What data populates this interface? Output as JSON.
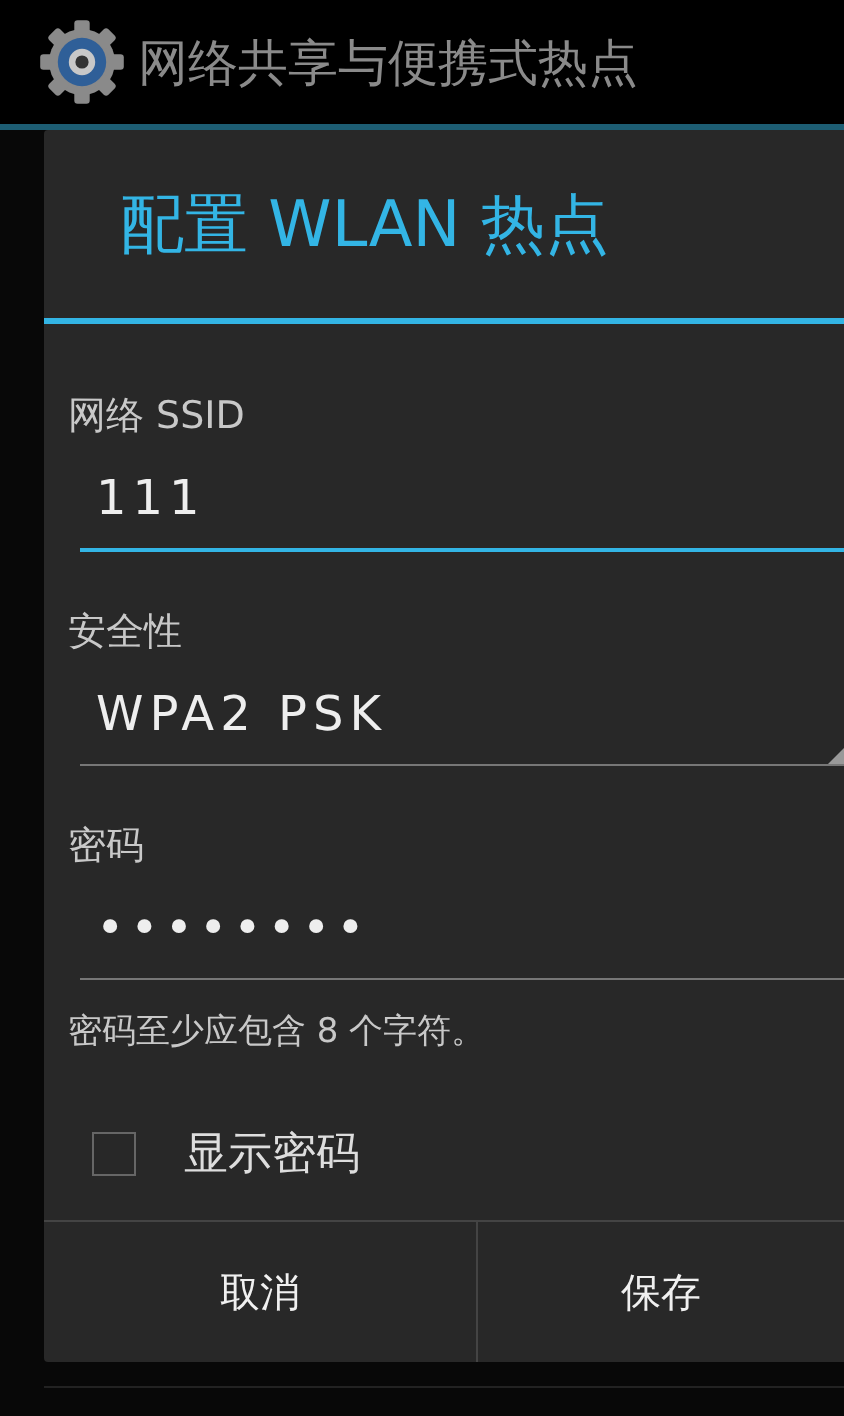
{
  "app_bar": {
    "title": "网络共享与便携式热点"
  },
  "dialog": {
    "title": "配置 WLAN 热点",
    "fields": [
      {
        "kind": "text",
        "label": "网络 SSID",
        "value": "111",
        "focused": true
      },
      {
        "kind": "spinner",
        "label": "安全性",
        "value": "WPA2 PSK",
        "focused": false
      },
      {
        "kind": "text",
        "label": "密码",
        "value": "••••••••",
        "focused": false
      }
    ],
    "hint": "密码至少应包含 8 个字符。",
    "show_password": {
      "label": "显示密码",
      "checked": false
    },
    "buttons": [
      "取消",
      "保存"
    ]
  }
}
